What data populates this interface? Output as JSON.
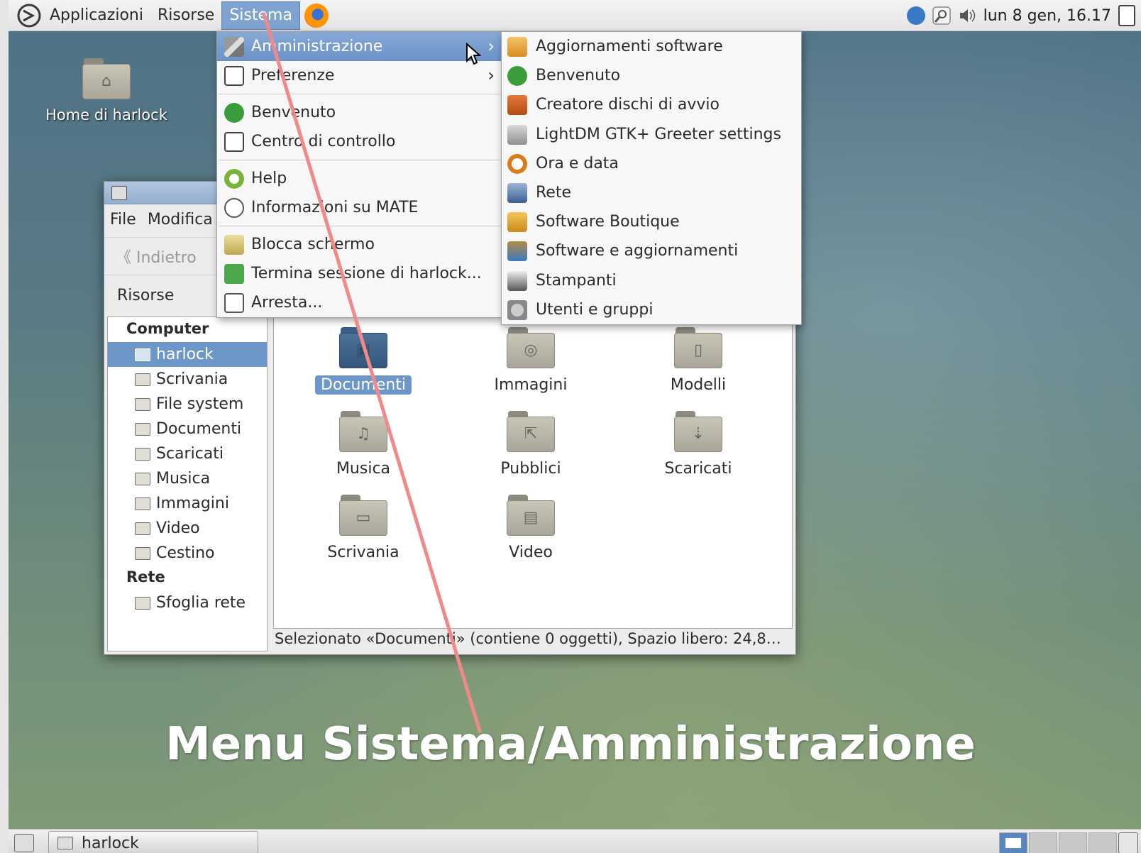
{
  "top_panel": {
    "menus": [
      "Applicazioni",
      "Risorse",
      "Sistema"
    ],
    "clock": "lun 8 gen, 16.17"
  },
  "desktop": {
    "home_icon_label": "Home di harlock"
  },
  "file_manager": {
    "menubar": [
      "File",
      "Modifica"
    ],
    "back_label": "Indietro",
    "sidebar_dropdown": "Risorse",
    "sidebar": {
      "sections": [
        {
          "heading": "Computer",
          "items": [
            "harlock",
            "Scrivania",
            "File system",
            "Documenti",
            "Scaricati",
            "Musica",
            "Immagini",
            "Video",
            "Cestino"
          ]
        },
        {
          "heading": "Rete",
          "items": [
            "Sfoglia rete"
          ]
        }
      ],
      "selected": "harlock"
    },
    "folders": [
      "Documenti",
      "Immagini",
      "Modelli",
      "Musica",
      "Pubblici",
      "Scaricati",
      "Scrivania",
      "Video"
    ],
    "selected_folder": "Documenti",
    "status": "Selezionato «Documenti» (contiene 0 oggetti), Spazio libero: 24,8…"
  },
  "system_menu": {
    "items": [
      {
        "label": "Amministrazione",
        "icon": "tools-icon",
        "submenu": true,
        "highlighted": true
      },
      {
        "label": "Preferenze",
        "icon": "preferences-icon",
        "submenu": true
      },
      {
        "label": "Benvenuto",
        "icon": "ubuntu-mate-icon"
      },
      {
        "label": "Centro di controllo",
        "icon": "control-center-icon"
      },
      {
        "label": "Help",
        "icon": "help-icon"
      },
      {
        "label": "Informazioni su MATE",
        "icon": "mate-logo-icon"
      },
      {
        "label": "Blocca schermo",
        "icon": "lock-screen-icon"
      },
      {
        "label": "Termina sessione di harlock...",
        "icon": "logout-icon"
      },
      {
        "label": "Arresta...",
        "icon": "power-icon"
      }
    ]
  },
  "admin_submenu": {
    "items": [
      {
        "label": "Aggiornamenti software",
        "icon": "software-update-icon"
      },
      {
        "label": "Benvenuto",
        "icon": "ubuntu-mate-icon"
      },
      {
        "label": "Creatore dischi di avvio",
        "icon": "startup-disk-icon"
      },
      {
        "label": "LightDM GTK+ Greeter settings",
        "icon": "lightdm-icon"
      },
      {
        "label": "Ora e data",
        "icon": "clock-icon"
      },
      {
        "label": "Rete",
        "icon": "network-icon"
      },
      {
        "label": "Software Boutique",
        "icon": "boutique-icon"
      },
      {
        "label": "Software e aggiornamenti",
        "icon": "software-sources-icon"
      },
      {
        "label": "Stampanti",
        "icon": "printer-icon"
      },
      {
        "label": "Utenti e gruppi",
        "icon": "users-icon"
      }
    ]
  },
  "caption": "Menu Sistema/Amministrazione",
  "bottom_panel": {
    "task_label": "harlock"
  }
}
